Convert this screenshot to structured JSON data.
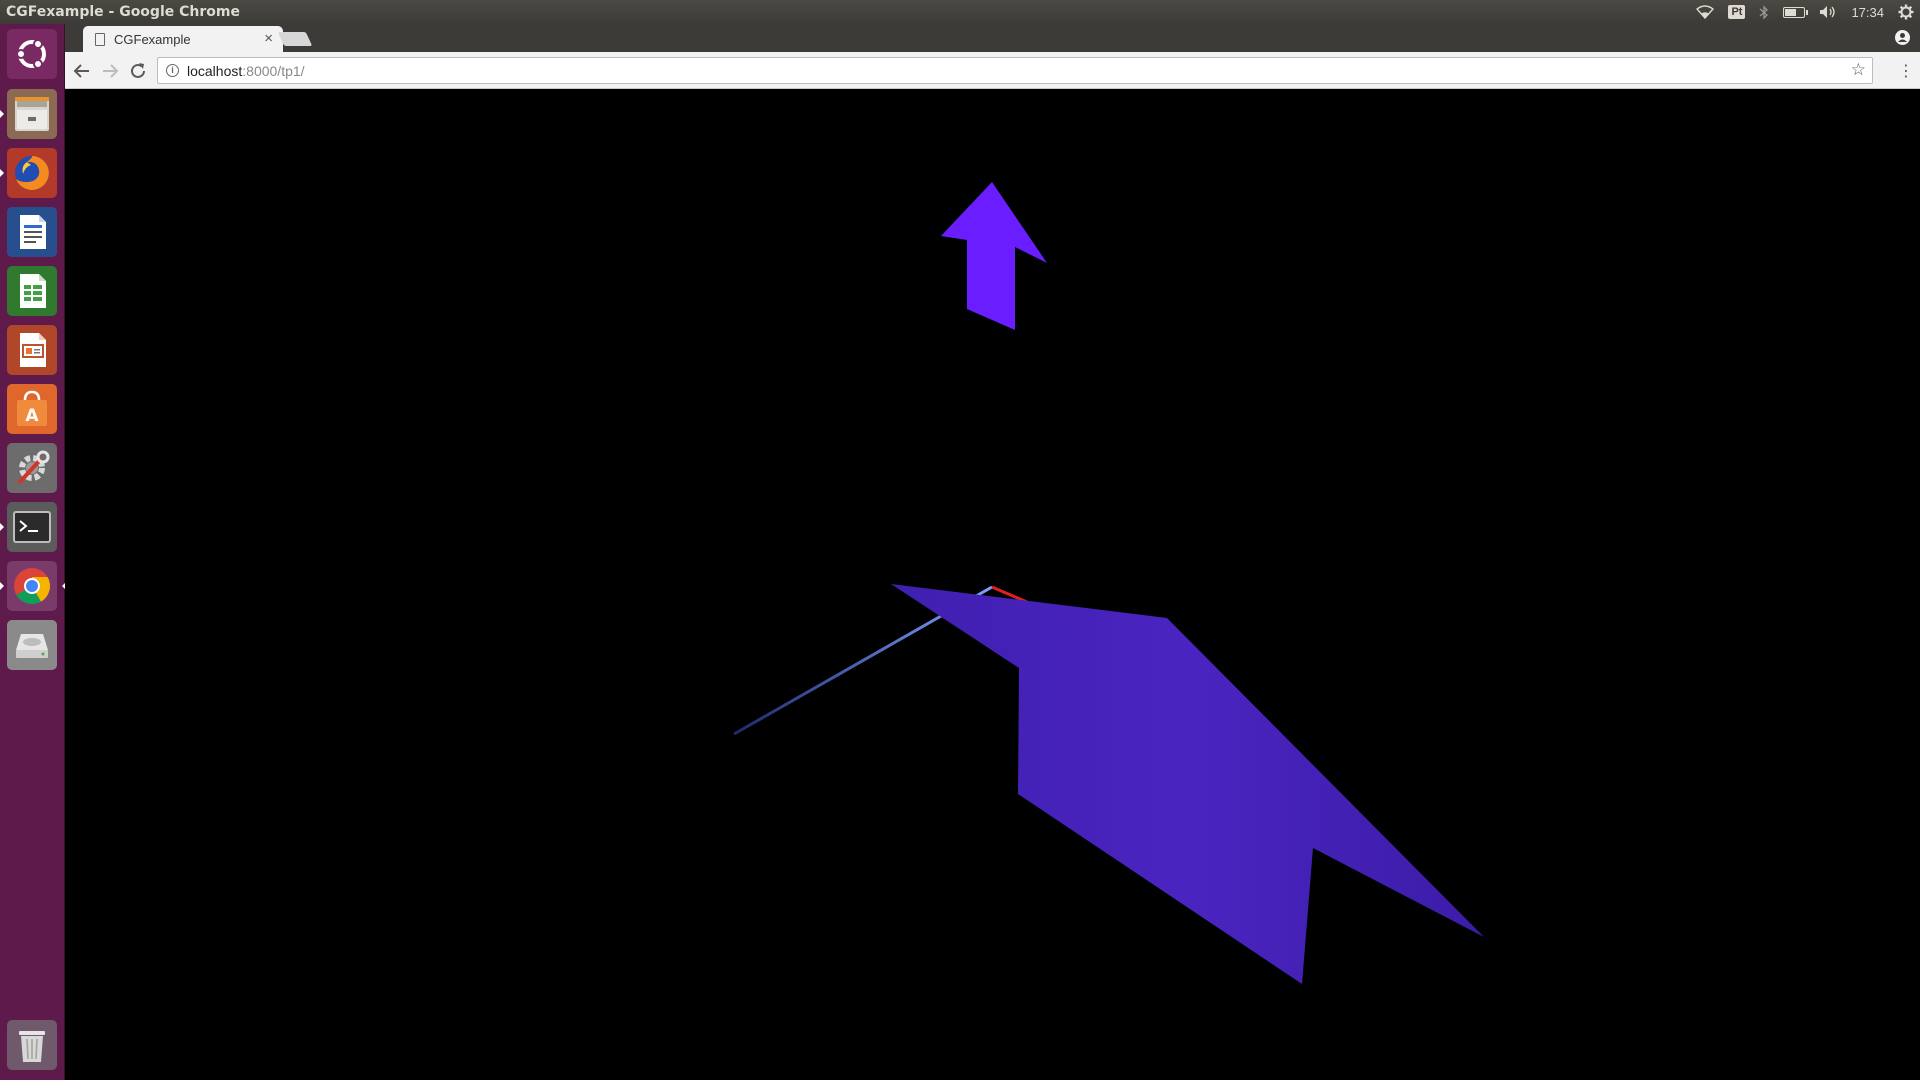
{
  "top_panel": {
    "window_title": "CGFexample - Google Chrome",
    "keyboard_layout": "Pt",
    "clock": "17:34",
    "battery_level_percent": 60,
    "icons": [
      "wifi-icon",
      "bluetooth-icon",
      "battery-icon",
      "volume-icon",
      "gear-icon"
    ]
  },
  "launcher": {
    "items": [
      {
        "name": "ubuntu-dash",
        "icon": "ubuntu-logo-icon"
      },
      {
        "name": "files",
        "icon": "file-cabinet-icon",
        "running": true
      },
      {
        "name": "firefox",
        "icon": "firefox-icon",
        "running": true
      },
      {
        "name": "libreoffice-writer",
        "icon": "writer-document-icon"
      },
      {
        "name": "libreoffice-calc",
        "icon": "calc-spreadsheet-icon"
      },
      {
        "name": "libreoffice-impress",
        "icon": "impress-presentation-icon"
      },
      {
        "name": "ubuntu-software",
        "icon": "software-bag-icon"
      },
      {
        "name": "system-settings",
        "icon": "settings-wrench-icon"
      },
      {
        "name": "terminal",
        "icon": "terminal-icon",
        "running": true
      },
      {
        "name": "google-chrome",
        "icon": "chrome-icon",
        "running": true,
        "focused": true
      },
      {
        "name": "disk-drive",
        "icon": "disk-icon"
      },
      {
        "name": "trash",
        "icon": "trash-icon"
      }
    ]
  },
  "browser": {
    "tab_title": "CGFexample",
    "url_host": "localhost",
    "url_rest": ":8000/tp1/"
  },
  "scene": {
    "background": "#000000",
    "colors": {
      "axis_x": "#e02020",
      "axis_y": "#1fd81f",
      "axis_z": "#6a8cff",
      "arrow": "#6a1eff",
      "shape": "#4420b8"
    }
  }
}
